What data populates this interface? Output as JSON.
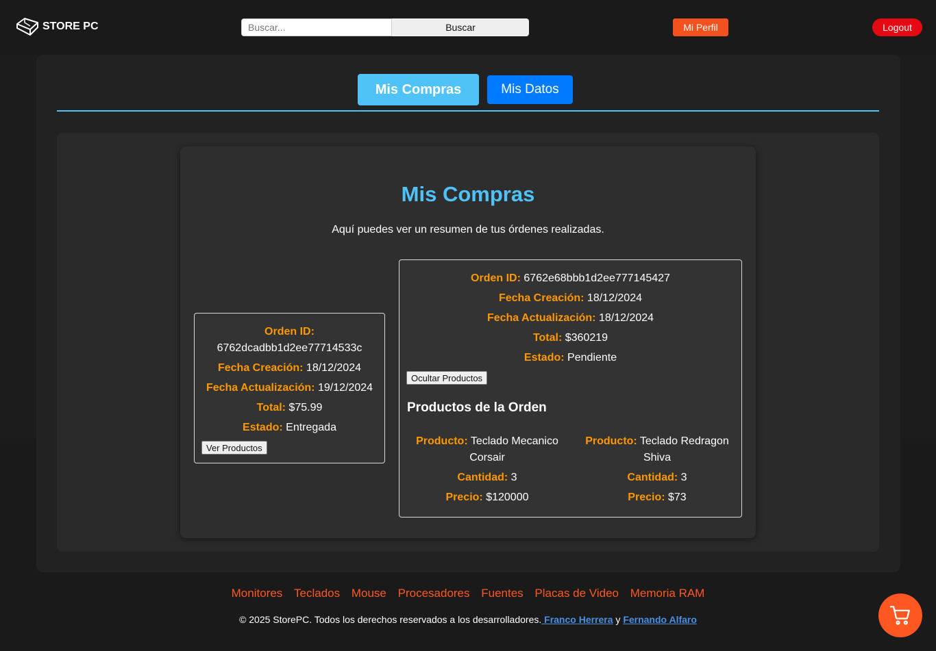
{
  "brand": {
    "name": "STORE PC",
    "logo_icon": "keyboard-key-icon"
  },
  "header": {
    "search_placeholder": "Buscar...",
    "search_button": "Buscar",
    "profile_button": "Mi Perfil",
    "logout_button": "Logout"
  },
  "tabs": [
    {
      "label": "Mis Compras",
      "active": true
    },
    {
      "label": "Mis Datos",
      "active": false
    }
  ],
  "orders_section": {
    "title": "Mis Compras",
    "subtitle": "Aquí puedes ver un resumen de tus órdenes realizadas."
  },
  "labels": {
    "order_id": "Orden ID:",
    "created": "Fecha Creación:",
    "updated": "Fecha Actualización:",
    "total": "Total:",
    "status": "Estado:",
    "product": "Producto:",
    "quantity": "Cantidad:",
    "price": "Precio:",
    "products_heading": "Productos de la Orden"
  },
  "orders": [
    {
      "id": "6762dcadbb1d2ee77714533c",
      "created": "18/12/2024",
      "updated": "19/12/2024",
      "total": "$75.99",
      "status": "Entregada",
      "button": "Ver Productos"
    },
    {
      "id": "6762e68bbb1d2ee777145427",
      "created": "18/12/2024",
      "updated": "18/12/2024",
      "total": "$360219",
      "status": "Pendiente",
      "button": "Ocultar Productos",
      "products": [
        {
          "name_line1": "Teclado Mecanico",
          "name_line2": "Corsair",
          "quantity": "3",
          "price": "$120000"
        },
        {
          "name_line1": "Teclado Redragon",
          "name_line2": "Shiva",
          "quantity": "3",
          "price": "$73"
        }
      ]
    }
  ],
  "footer": {
    "categories": [
      "Monitores",
      "Teclados",
      "Mouse",
      "Procesadores",
      "Fuentes",
      "Placas de Video",
      "Memoria RAM"
    ],
    "copyright": "© 2025 StorePC. Todos los derechos reservados a los desarrolladores.",
    "dev1": " Franco Herrera",
    "and": " y ",
    "dev2": "Fernando Alfaro"
  },
  "cart": {
    "icon": "shopping-cart-icon"
  },
  "colors": {
    "accent": "#4fc3f7",
    "label": "#ff9800",
    "profile": "#f4511e",
    "logout": "#e50914",
    "tab_secondary": "#007bff",
    "footer_link": "#ff5722",
    "dev_link": "#4a90e2"
  }
}
